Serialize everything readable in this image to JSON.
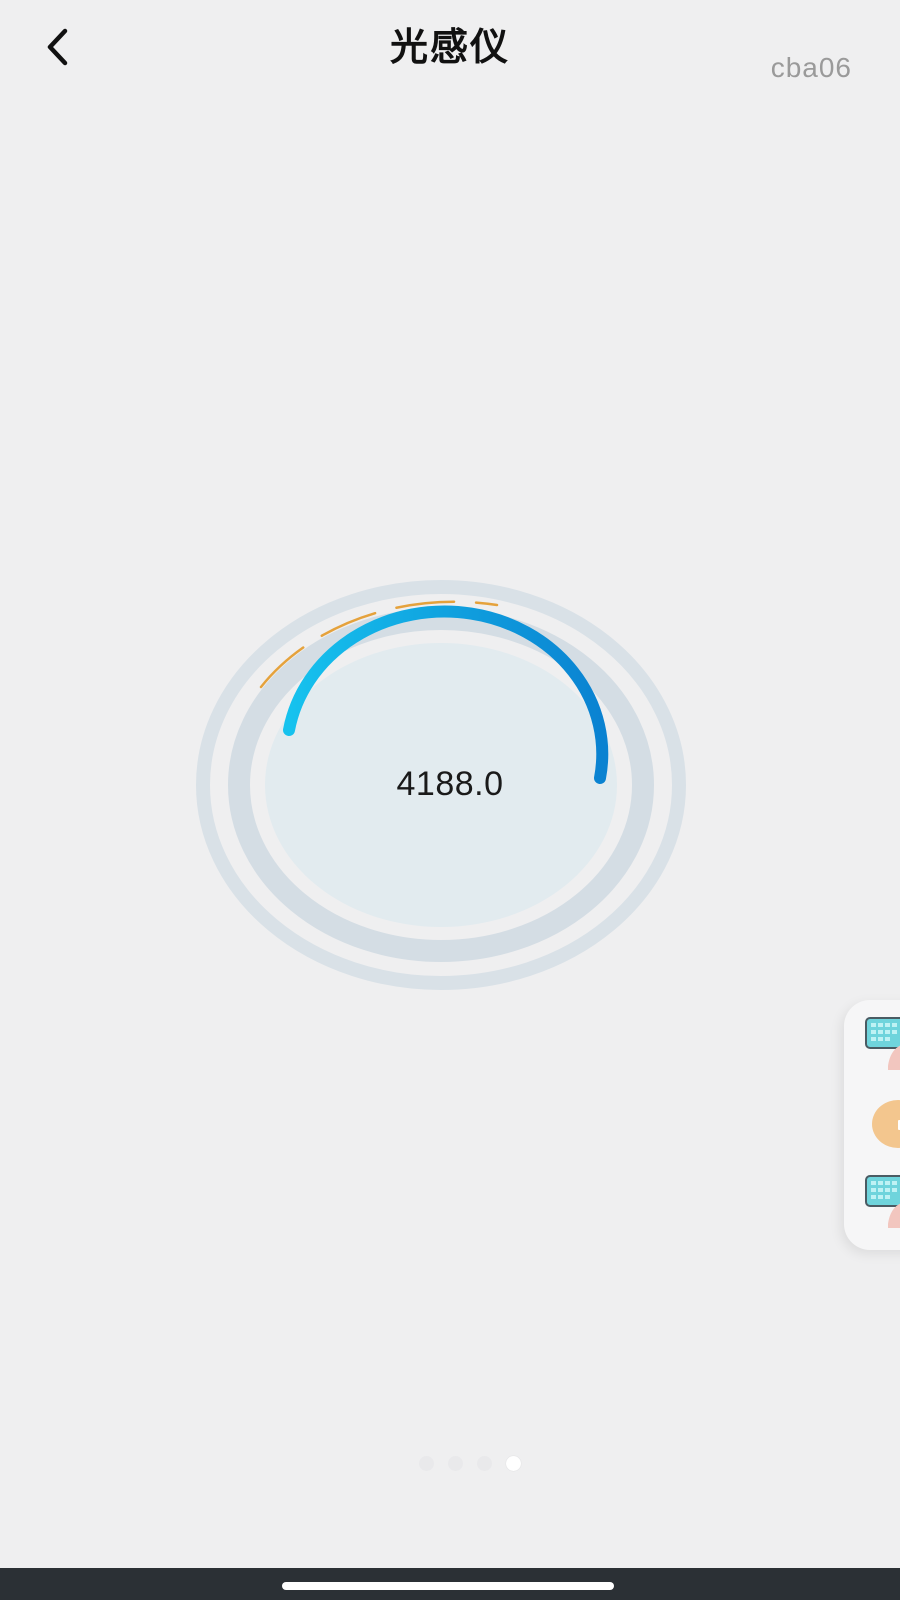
{
  "header": {
    "title": "光感仪",
    "device_id": "cba06",
    "back_icon": "chevron-left-icon"
  },
  "gauge": {
    "value": "4188.0",
    "track_color": "#d3dde3",
    "inner_fill": "#e2ebef",
    "arc_start_color": "#16c2ee",
    "arc_end_color": "#0a82d1",
    "accent_dash_color": "#e5a23c"
  },
  "side_dock": {
    "items": [
      {
        "icon": "keyboard-hand-icon"
      },
      {
        "icon": "coin-icon"
      },
      {
        "icon": "keyboard-hand-icon"
      }
    ]
  },
  "pager": {
    "pages": 4,
    "active_index": 3
  }
}
